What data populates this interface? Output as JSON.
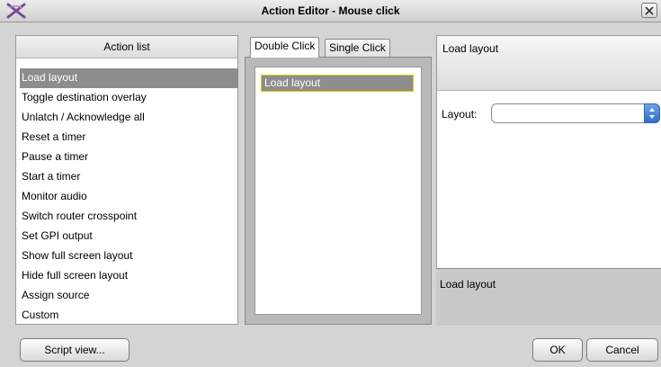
{
  "window": {
    "title": "Action Editor - Mouse click"
  },
  "left_panel": {
    "header": "Action list",
    "selected_index": 0,
    "items": [
      "Load layout",
      "Toggle destination overlay",
      "Unlatch / Acknowledge all",
      "Reset a timer",
      "Pause a timer",
      "Start a timer",
      "Monitor audio",
      "Switch router crosspoint",
      "Set GPI output",
      "Show full screen layout",
      "Hide full screen layout",
      "Assign source",
      "Custom"
    ]
  },
  "tabs": {
    "double_click": "Double Click",
    "single_click": "Single Click",
    "active": "Double Click",
    "items": [
      "Load layout"
    ]
  },
  "right_panel": {
    "header": "Load layout",
    "layout_label": "Layout:",
    "layout_value": "",
    "description": "Load layout"
  },
  "buttons": {
    "script_view": "Script view...",
    "ok": "OK",
    "cancel": "Cancel"
  },
  "colors": {
    "selection": "#8d8d8d",
    "focus_border": "#e2cc00",
    "select_arrow": "#2d6bd4",
    "app_icon": "#7a4a9a"
  }
}
